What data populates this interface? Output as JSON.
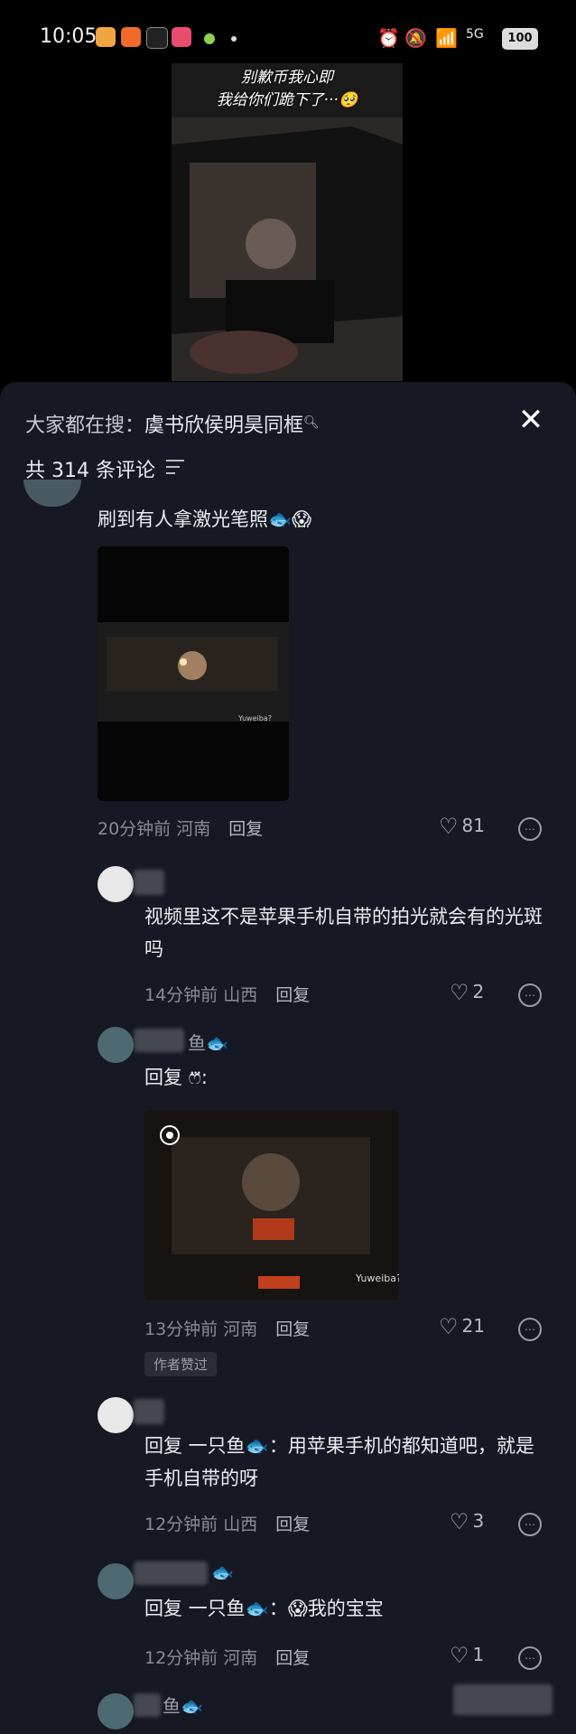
{
  "status_bar": {
    "time": "10:05",
    "network": "5G",
    "battery": "100"
  },
  "video": {
    "caption_line1": "别歉币我心即",
    "caption_line2": "我给你们跪下了···🥺"
  },
  "panel": {
    "search_prefix": "大家都在搜：",
    "search_term": "虞书欣侯明昊同框",
    "search_icon": "search-icon",
    "close_label": "✕",
    "comment_count": "共 314 条评论"
  },
  "comments": [
    {
      "text": "刷到有人拿激光笔照🐟😱",
      "time": "20分钟前",
      "location": "河南",
      "reply_label": "回复",
      "likes": "81",
      "video_watermark": "Yuweiba?"
    },
    {
      "text": "视频里这不是苹果手机自带的拍光就会有的光斑吗",
      "time": "14分钟前",
      "location": "山西",
      "reply_label": "回复",
      "likes": "2"
    },
    {
      "username": "鱼🐟",
      "text": "回复 ෆ⃛:",
      "time": "13分钟前",
      "location": "河南",
      "reply_label": "回复",
      "likes": "21",
      "author_tag": "作者赞过",
      "image_watermark": "Yuweiba?"
    },
    {
      "text": "回复 一只鱼🐟：用苹果手机的都知道吧，就是手机自带的呀",
      "time": "12分钟前",
      "location": "山西",
      "reply_label": "回复",
      "likes": "3"
    },
    {
      "username": "🐟",
      "text": "回复 一只鱼🐟：😱我的宝宝",
      "time": "12分钟前",
      "location": "河南",
      "reply_label": "回复",
      "likes": "1"
    },
    {
      "username": "鱼🐟"
    }
  ],
  "colors": {
    "panel_bg": "#161823",
    "text": "#ececf0",
    "meta": "#8a8b94"
  }
}
